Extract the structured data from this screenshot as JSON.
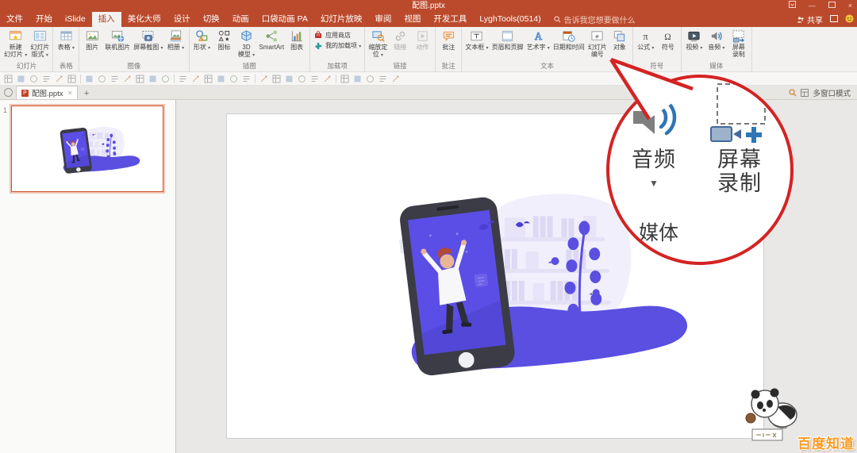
{
  "titlebar": {
    "title": "配图.pptx",
    "share_label": "共享"
  },
  "tabs": {
    "search_label": "告诉我您想要做什么",
    "items": [
      {
        "id": "file",
        "label": "文件"
      },
      {
        "id": "home",
        "label": "开始"
      },
      {
        "id": "islide",
        "label": "iSlide"
      },
      {
        "id": "insert",
        "label": "插入",
        "active": true
      },
      {
        "id": "meihua-dashi",
        "label": "美化大师"
      },
      {
        "id": "design",
        "label": "设计"
      },
      {
        "id": "transitions",
        "label": "切换"
      },
      {
        "id": "animations",
        "label": "动画"
      },
      {
        "id": "pocket-animation-pa",
        "label": "口袋动画 PA"
      },
      {
        "id": "slideshow",
        "label": "幻灯片放映"
      },
      {
        "id": "review",
        "label": "审阅"
      },
      {
        "id": "view",
        "label": "视图"
      },
      {
        "id": "developer",
        "label": "开发工具"
      },
      {
        "id": "lyghtools",
        "label": "LyghTools(0514)"
      }
    ]
  },
  "ribbon": {
    "groups": [
      {
        "id": "slides",
        "label": "幻灯片",
        "buttons": [
          {
            "id": "new-slide",
            "icon": "new-slide",
            "lines": [
              "新建",
              "幻灯片"
            ],
            "caret": true
          },
          {
            "id": "slide-layout",
            "icon": "layout",
            "lines": [
              "幻灯片",
              "版式"
            ],
            "caret": true
          }
        ]
      },
      {
        "id": "table",
        "label": "表格",
        "buttons": [
          {
            "id": "table",
            "icon": "table",
            "lines": [
              "表格"
            ],
            "caret": true
          }
        ]
      },
      {
        "id": "images",
        "label": "图像",
        "buttons": [
          {
            "id": "picture",
            "icon": "picture",
            "lines": [
              "图片"
            ]
          },
          {
            "id": "online-picture",
            "icon": "online-picture",
            "lines": [
              "联机图片"
            ]
          },
          {
            "id": "screenshot",
            "icon": "screenshot",
            "lines": [
              "屏幕截图"
            ],
            "caret": true
          },
          {
            "id": "album",
            "icon": "album",
            "lines": [
              "相册"
            ],
            "caret": true
          }
        ]
      },
      {
        "id": "illustrations",
        "label": "插图",
        "buttons": [
          {
            "id": "shapes",
            "icon": "shapes",
            "lines": [
              "形状"
            ],
            "caret": true
          },
          {
            "id": "icons",
            "icon": "icons",
            "lines": [
              "图标"
            ]
          },
          {
            "id": "3d-model",
            "icon": "model3d",
            "lines": [
              "3D",
              "模型"
            ],
            "caret": true
          },
          {
            "id": "smartart",
            "icon": "smartart",
            "lines": [
              "SmartArt"
            ]
          },
          {
            "id": "chart",
            "icon": "chart",
            "lines": [
              "图表"
            ]
          }
        ]
      },
      {
        "id": "addins",
        "label": "加载项",
        "stack": true,
        "buttons": [
          {
            "id": "store",
            "icon": "store",
            "lines": [
              "应用商店"
            ],
            "small": true
          },
          {
            "id": "my-addins",
            "icon": "addin",
            "lines": [
              "我的加载项"
            ],
            "small": true,
            "caret": true
          }
        ]
      },
      {
        "id": "links",
        "label": "链接",
        "buttons": [
          {
            "id": "zoom-section",
            "icon": "zoomsec",
            "lines": [
              "缩放定",
              "位"
            ],
            "caret": true
          },
          {
            "id": "link",
            "icon": "link",
            "lines": [
              "链接"
            ],
            "disabled": true
          },
          {
            "id": "action",
            "icon": "action",
            "lines": [
              "动作"
            ],
            "disabled": true
          }
        ]
      },
      {
        "id": "comments",
        "label": "批注",
        "buttons": [
          {
            "id": "comment",
            "icon": "comment",
            "lines": [
              "批注"
            ]
          }
        ]
      },
      {
        "id": "text",
        "label": "文本",
        "buttons": [
          {
            "id": "textbox",
            "icon": "textbox",
            "lines": [
              "文本框"
            ],
            "caret": true
          },
          {
            "id": "header-footer",
            "icon": "headerfooter",
            "lines": [
              "页眉和页脚"
            ]
          },
          {
            "id": "wordart",
            "icon": "wordart",
            "lines": [
              "艺术字"
            ],
            "caret": true
          },
          {
            "id": "datetime",
            "icon": "datetime",
            "lines": [
              "日期和时间"
            ]
          },
          {
            "id": "slide-number",
            "icon": "slidenumber",
            "lines": [
              "幻灯片",
              "编号"
            ]
          },
          {
            "id": "object",
            "icon": "object",
            "lines": [
              "对象"
            ]
          }
        ]
      },
      {
        "id": "symbols",
        "label": "符号",
        "buttons": [
          {
            "id": "equation",
            "icon": "equation",
            "lines": [
              "公式"
            ],
            "caret": true
          },
          {
            "id": "symbol",
            "icon": "symbol",
            "lines": [
              "符号"
            ]
          }
        ]
      },
      {
        "id": "media",
        "label": "媒体",
        "buttons": [
          {
            "id": "video",
            "icon": "video",
            "lines": [
              "视频"
            ],
            "caret": true
          },
          {
            "id": "audio",
            "icon": "audio",
            "lines": [
              "音频"
            ],
            "caret": true
          },
          {
            "id": "screen-record",
            "icon": "screenrec",
            "lines": [
              "屏幕",
              "录制"
            ]
          }
        ]
      }
    ]
  },
  "toolstrip": {
    "icon_count": 30
  },
  "docbar": {
    "tab_label": "配图.pptx",
    "new_tab_label": "+",
    "mode_label": "多窗口模式"
  },
  "panel": {
    "slide_number": "1"
  },
  "callout": {
    "audio_label": "音频",
    "screen_line1": "屏幕",
    "screen_line2": "录制",
    "group_label": "媒体",
    "circle_color": "#d42323"
  },
  "watermark": {
    "text": "百度知道"
  },
  "accent_colors": {
    "window": "#bb4a2c",
    "purple": "#5a4fe1",
    "screen_purple": "#5b4ee6"
  }
}
